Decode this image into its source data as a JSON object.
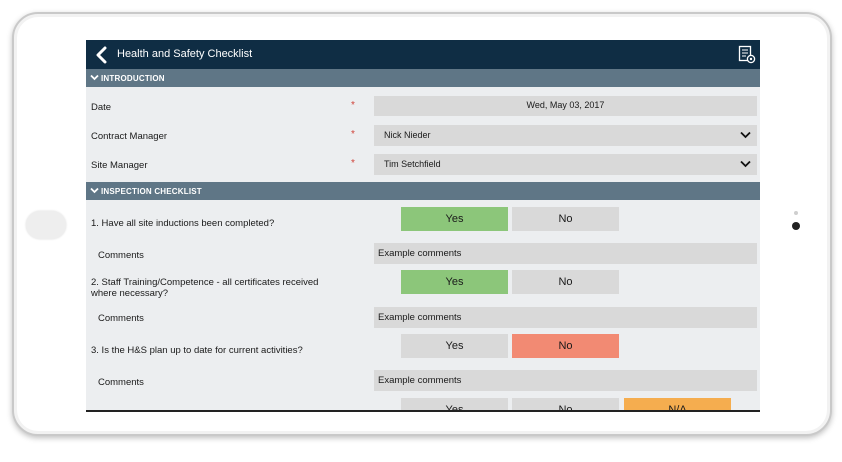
{
  "header": {
    "title": "Health and Safety Checklist",
    "back_icon": "chevron-left-icon",
    "report_icon": "document-settings-icon"
  },
  "sections": {
    "introduction": "INTRODUCTION",
    "inspection": "INSPECTION CHECKLIST"
  },
  "intro": {
    "date_label": "Date",
    "date_value": "Wed, May 03, 2017",
    "contract_manager_label": "Contract Manager",
    "contract_manager_value": "Nick Nieder",
    "site_manager_label": "Site Manager",
    "site_manager_value": "Tim Setchfield",
    "required_mark": "*"
  },
  "questions": [
    {
      "text": "1. Have all site inductions been completed?",
      "yes": "Yes",
      "no": "No",
      "selected": "yes",
      "comments_label": "Comments",
      "comments_value": "Example comments"
    },
    {
      "text_line1": "2. Staff Training/Competence - all certificates received",
      "text_line2": "where necessary?",
      "yes": "Yes",
      "no": "No",
      "selected": "yes",
      "comments_label": "Comments",
      "comments_value": "Example comments"
    },
    {
      "text": "3. Is the H&S plan up to date for current activities?",
      "yes": "Yes",
      "no": "No",
      "selected": "no",
      "comments_label": "Comments",
      "comments_value": "Example comments"
    },
    {
      "yes": "Yes",
      "no": "No",
      "na": "N/A",
      "selected": "na"
    }
  ],
  "colors": {
    "header_bg": "#0f2d44",
    "section_bg": "#5f7686",
    "yes_selected": "#8cc67a",
    "no_selected": "#f28a73",
    "na_selected": "#f5ad4f",
    "required": "#d0433a"
  }
}
